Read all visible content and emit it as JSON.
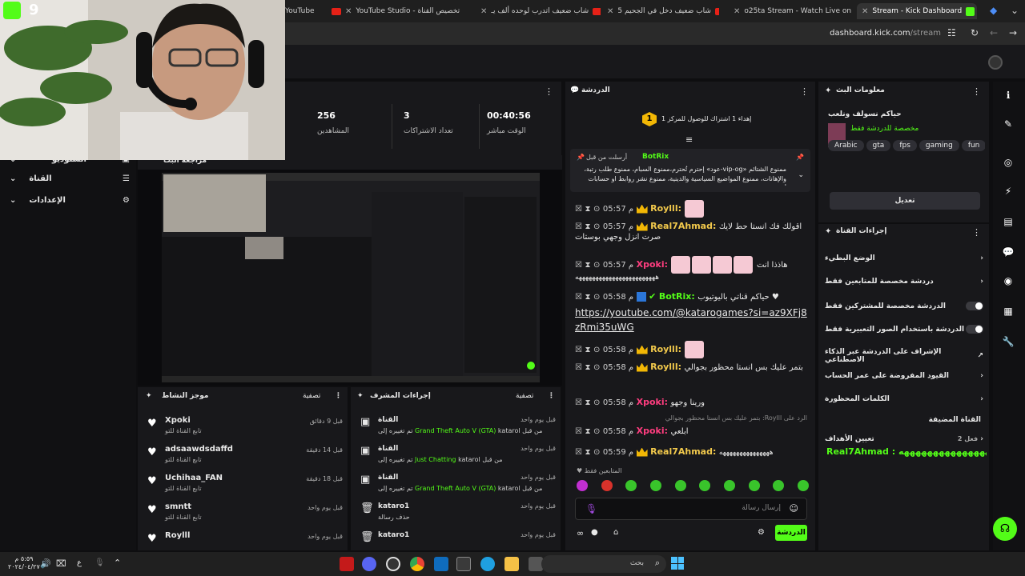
{
  "browser": {
    "tabs": [
      {
        "label": "YouTube"
      },
      {
        "label": "YouTube Studio - تخصيص القناة"
      },
      {
        "label": "شاب ضعيف اتدرب لوحده ألف يـ"
      },
      {
        "label": "شاب ضعيف دخل في الجحيم 5"
      },
      {
        "label": "o25ta Stream - Watch Live on"
      },
      {
        "label": "Stream - Kick Dashboard"
      }
    ],
    "url_host": "dashboard.kick.com",
    "url_path": "/stream"
  },
  "sidebar": {
    "items": [
      {
        "label": "الستوديو"
      },
      {
        "label": "القناة"
      },
      {
        "label": "الإعدادات"
      }
    ]
  },
  "stats": {
    "viewers_value": "256",
    "viewers_label": "المشاهدين",
    "subs_value": "3",
    "subs_label": "تعداد الاشتراكات",
    "live_value": "00:40:56",
    "live_label": "الوقت مباشر"
  },
  "preview": {
    "title": "مراجعة البث"
  },
  "activity": {
    "title": "موجز النشاط",
    "filter": "تصفية",
    "items": [
      {
        "user": "Xpoki",
        "action": "تابع القناة للتو",
        "time": "قبل 9 دقائق"
      },
      {
        "user": "adsaawdsdaffd",
        "action": "تابع القناة للتو",
        "time": "قبل 14 دقيقة"
      },
      {
        "user": "Uchihaa_FAN",
        "action": "تابع القناة للتو",
        "time": "قبل 18 دقيقة"
      },
      {
        "user": "smntt",
        "action": "تابع القناة للتو",
        "time": "قبل يوم واحد"
      },
      {
        "user": "Roylll",
        "action": "تابع القناة للتو",
        "time": "قبل يوم واحد"
      }
    ]
  },
  "mod_actions": {
    "title": "إجراءات المشرف",
    "filter": "تصفية",
    "items": [
      {
        "head": "القناة",
        "detail_green": "Grand Theft Auto V (GTA)",
        "detail": "تم تغييره إلى",
        "by": "katarol من قبل",
        "time": "قبل يوم واحد"
      },
      {
        "head": "القناة",
        "detail_green": "Just Chatting",
        "detail": "تم تغييره إلى",
        "by": "katarol من قبل",
        "time": "قبل يوم واحد"
      },
      {
        "head": "القناة",
        "detail_green": "Grand Theft Auto V (GTA)",
        "detail": "تم تغييره إلى",
        "by": "katarol من قبل",
        "time": "قبل يوم واحد"
      },
      {
        "head": "kataro1",
        "detail_green": "",
        "detail": "حذف رسالة",
        "by": "",
        "time": "قبل يوم واحد"
      },
      {
        "head": "kataro1",
        "detail_green": "",
        "detail": "",
        "by": "",
        "time": "قبل يوم واحد"
      }
    ]
  },
  "chat": {
    "title": "الدردشة",
    "goal_text": "إهداء 1 اشتراك للوصول للمركز 1",
    "goal_rank": "1",
    "pinned_by": "أرسلت من قبل",
    "pinned_user": "BotRix",
    "pinned_text": "ممنوع الشتائم «vip-og-عود» إحترم تُحترم،ممنوع السبام، ممنوع طلب رتبة، والإهانات، ممنوع المواضيع السياسية والدينية، ممنوع نشر روابط او حسابات أو...",
    "messages": [
      {
        "time": "05:57 م",
        "user": "Roylll:",
        "text": ""
      },
      {
        "time": "05:57 م",
        "user": "Real7Ahmad:",
        "text": "اقولك فك انستا حط لايك صرت انزل وجهي بوستات"
      },
      {
        "time": "05:57 م",
        "user": "Xpoki:",
        "text": "هاذذا انت"
      },
      {
        "time": "",
        "user": "",
        "text": "ههههههههههههههههههههههههه"
      },
      {
        "time": "05:58 م",
        "user": "BotRix:",
        "text": "حياكم قناتي باليوتيوب ♥"
      },
      {
        "time": "",
        "user": "",
        "text": "https://youtube.com/@katarogames?si=az9XFj8zRmi35uWG"
      },
      {
        "time": "05:58 م",
        "user": "Roylll:",
        "text": ""
      },
      {
        "time": "05:58 م",
        "user": "Roylll:",
        "text": "بتمر عليك بس انستا محظور بجوالي"
      },
      {
        "time": "05:58 م",
        "user": "Xpoki:",
        "text": "ورينا وجهو"
      },
      {
        "time": "",
        "user": "",
        "text": "الرد على Roylll: بتمر عليك بس انستا محظور بجوالي"
      },
      {
        "time": "05:58 م",
        "user": "Xpoki:",
        "text": "ابلعي"
      },
      {
        "time": "05:59 م",
        "user": "Real7Ahmad:",
        "text": "هههههههههههههههه"
      }
    ],
    "mode_label": "المتابعين فقط",
    "input_placeholder": "إرسال رسالة",
    "send_label": "الدردشة"
  },
  "stream_info": {
    "title": "معلومات البث",
    "stream_title": "حياكم نسولف ونلعب",
    "stream_sub": "مخصصة للدردشة فقط",
    "tags": [
      "Arabic",
      "gta",
      "fps",
      "gaming",
      "fun"
    ],
    "edit_label": "تعديل"
  },
  "channel_actions": {
    "title": "إجراءات القناة",
    "rows": [
      {
        "label": "الوضع البطيء"
      },
      {
        "label": "دردشة مخصصة للمتابعين فقط"
      },
      {
        "label": "الدردشة مخصصة للمشتركين فقط"
      },
      {
        "label": "الدردشة باستخدام الصور التعبيرية فقط"
      },
      {
        "label": "الإشراف على الدردشة عبر الذكاء الاصطناعي"
      },
      {
        "label": "القيود المفروضة على عمر الحساب"
      },
      {
        "label": "الكلمات المحظورة"
      }
    ],
    "hosted": "القناة المضيفة",
    "goals_label": "تعيين الأهداف",
    "goals_count": "فعل 2",
    "ticker": "Real7Ahmad : ههههههههههههههههه"
  },
  "taskbar": {
    "search": "بحث",
    "clock_time": "٥:٥٩ م",
    "clock_date": "٢٠٢٤/٠٤/٢٧",
    "lang": "ع"
  },
  "colors": {
    "kick_green": "#53fc18",
    "pink_user": "#ff3d7f",
    "gold_user": "#f2c94c"
  }
}
